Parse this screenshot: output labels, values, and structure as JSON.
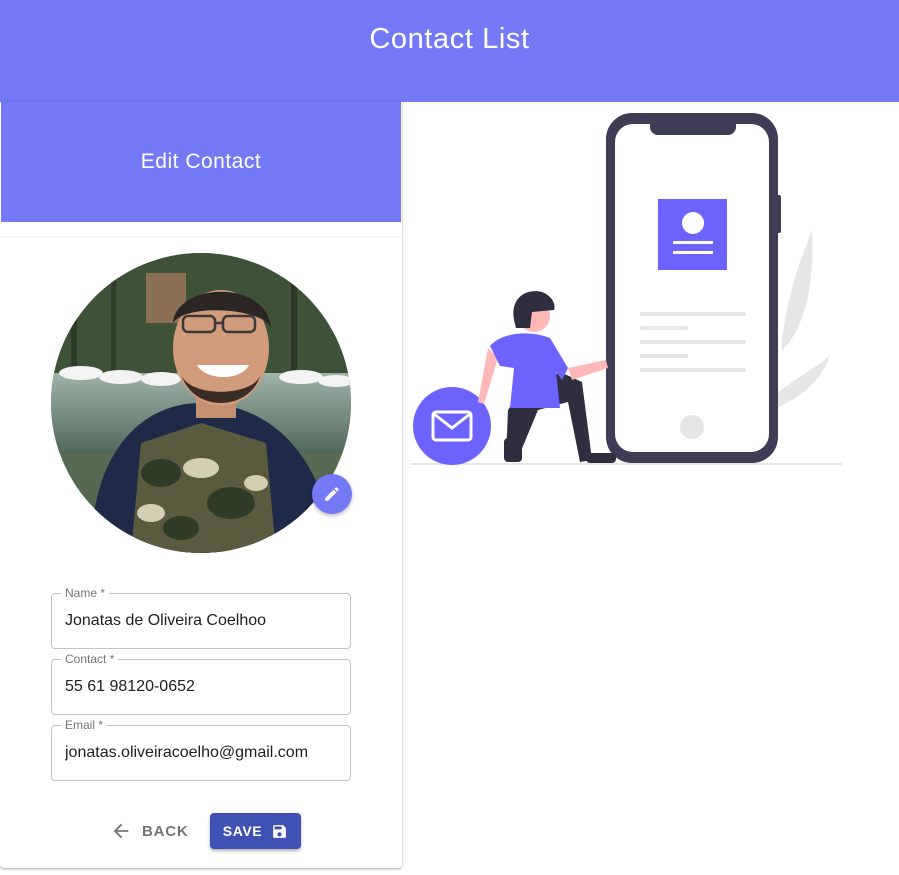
{
  "app": {
    "title": "Contact List"
  },
  "card": {
    "title": "Edit Contact"
  },
  "avatar": {
    "alt": "Contact photo",
    "edit_icon": "pencil-icon"
  },
  "form": {
    "name_label": "Name *",
    "name_value": "Jonatas de Oliveira Coelhoo",
    "contact_label": "Contact *",
    "contact_value": "55 61 98120-0652",
    "email_label": "Email *",
    "email_value": "jonatas.oliveiracoelho@gmail.com"
  },
  "actions": {
    "back_label": "BACK",
    "back_icon": "arrow-left-icon",
    "save_label": "SAVE",
    "save_icon": "floppy-disk-icon"
  },
  "colors": {
    "primary": "#7479f6",
    "save_button": "#3f51b5",
    "illustration_dark": "#3f3d56"
  }
}
